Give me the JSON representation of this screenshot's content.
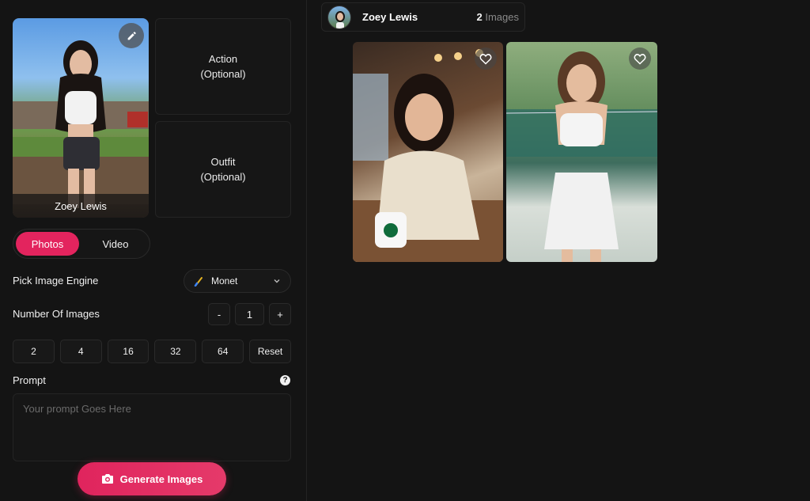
{
  "character": {
    "name": "Zoey Lewis"
  },
  "slots": {
    "action_title": "Action",
    "action_sub": "(Optional)",
    "outfit_title": "Outfit",
    "outfit_sub": "(Optional)"
  },
  "mode": {
    "photos_label": "Photos",
    "video_label": "Video",
    "active": "Photos"
  },
  "engine": {
    "label": "Pick Image Engine",
    "selected": "Monet"
  },
  "number_of_images": {
    "label": "Number Of Images",
    "minus": "-",
    "value": "1",
    "plus": "+"
  },
  "presets": [
    "2",
    "4",
    "16",
    "32",
    "64",
    "Reset"
  ],
  "prompt": {
    "label": "Prompt",
    "help": "?",
    "placeholder": "Your prompt Goes Here"
  },
  "generate_label": "Generate Images",
  "header": {
    "name": "Zoey Lewis",
    "count": "2",
    "count_suffix": " Images"
  },
  "colors": {
    "accent": "#e3245e",
    "background": "#141414"
  },
  "icons": {
    "edit": "pencil-icon",
    "favorite": "heart-icon",
    "camera": "camera-icon",
    "chevron": "chevron-down-icon",
    "engine": "paintbrush-icon"
  }
}
